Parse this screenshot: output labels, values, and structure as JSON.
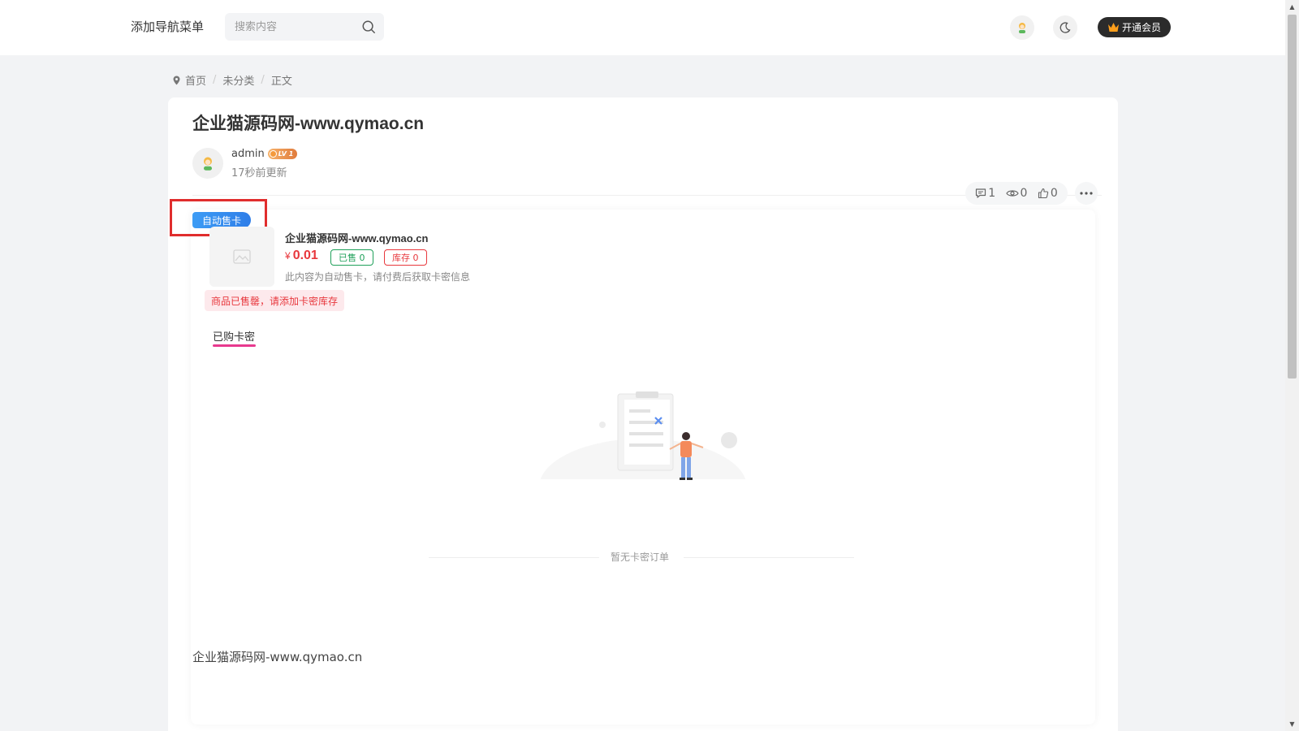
{
  "header": {
    "nav_menu": "添加导航菜单",
    "search_placeholder": "搜索内容",
    "vip_label": "开通会员"
  },
  "breadcrumb": {
    "items": [
      "首页",
      "未分类",
      "正文"
    ],
    "separator": "/"
  },
  "post": {
    "title": "企业猫源码网-www.qymao.cn",
    "author": "admin",
    "level_badge": "LV 1",
    "updated": "17秒前更新",
    "stats": {
      "comments": "1",
      "views": "0",
      "likes": "0"
    },
    "body_text": "企业猫源码网-www.qymao.cn"
  },
  "product": {
    "tag": "自动售卡",
    "name": "企业猫源码网-www.qymao.cn",
    "currency": "¥",
    "price": "0.01",
    "sold_label": "已售 0",
    "stock_label": "库存 0",
    "description": "此内容为自动售卡，请付费后获取卡密信息",
    "soldout_notice": "商品已售罄，请添加卡密库存",
    "tab_label": "已购卡密",
    "empty_text": "暂无卡密订单"
  },
  "colors": {
    "accent_red": "#e8383d",
    "accent_green": "#1fa05a",
    "tag_blue": "#2f7ee8",
    "tab_pink": "#e8398e",
    "highlight_red": "#e02d2d"
  }
}
